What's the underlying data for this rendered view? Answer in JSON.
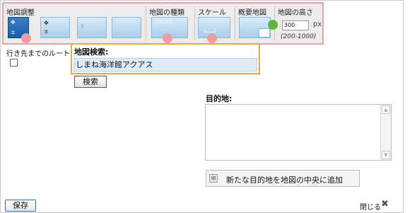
{
  "toolbar": {
    "map_controls": {
      "title": "地図調整"
    },
    "map_type": {
      "title": "地図の種類"
    },
    "scale": {
      "title": "スケール"
    },
    "overview": {
      "title": "概要地図"
    },
    "map_height": {
      "title": "地図の高さ",
      "value": "300",
      "unit": "px",
      "range": "(200-1000)"
    }
  },
  "route": {
    "label": "行き先までのルート",
    "checked": false
  },
  "search": {
    "title": "地図検索:",
    "value": "しまね海洋館アクアス",
    "button_label": "検索"
  },
  "destination": {
    "label": "目的地:",
    "value": ""
  },
  "add_destination": {
    "label": "新たな目的地を地図の中央に追加"
  },
  "footer": {
    "save_label": "保存",
    "close_label": "閉じる"
  },
  "colors": {
    "selected_button": "#1e5ea8",
    "marker_pink": "#f19aa0",
    "marker_green": "#5cb835",
    "search_highlight": "#f0a640",
    "toolbar_highlight": "#f0a0a4"
  }
}
